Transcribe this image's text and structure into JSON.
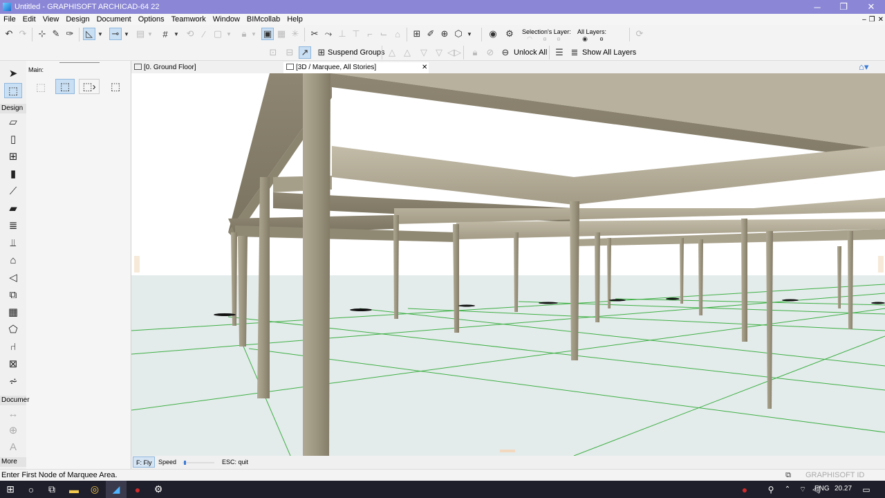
{
  "window": {
    "title": "Untitled - GRAPHISOFT ARCHICAD-64 22",
    "minimize": "─",
    "restore": "❐",
    "close": "✕"
  },
  "menu": {
    "items": [
      "File",
      "Edit",
      "View",
      "Design",
      "Document",
      "Options",
      "Teamwork",
      "Window",
      "BIMcollab",
      "Help"
    ],
    "controls": [
      "–",
      "❐",
      "✕"
    ]
  },
  "toolbar": {
    "selection_layer_label": "Selection's Layer:",
    "all_layers_label": "All Layers:",
    "suspend_groups_label": "Suspend Groups",
    "unlock_all_label": "Unlock All",
    "show_all_layers_label": "Show All Layers"
  },
  "info_box": {
    "main_label": "Main:"
  },
  "toolbox": {
    "design_label": "Design",
    "document_label": "Documer",
    "more_label": "More"
  },
  "tabs": [
    {
      "label": "[0. Ground Floor]",
      "close": ""
    },
    {
      "label": "[3D / Marquee, All Stories]",
      "close": "✕"
    }
  ],
  "fly_bar": {
    "mode_label": "F: Fly",
    "speed_label": "Speed",
    "quit_label": "ESC: quit",
    "speed_level": 0.05
  },
  "status": {
    "prompt": "Enter First Node of Marquee Area.",
    "brand": "GRAPHISOFT ID"
  },
  "taskbar": {
    "language": "ENG",
    "time": "20.27"
  },
  "colors": {
    "title_bar": "#8b87d6",
    "selection_blue": "#c9dff3",
    "concrete": "#a49c88",
    "grid_green": "#3cb043",
    "ground": "#e4ebeb",
    "taskbar": "#1f1f2b"
  }
}
